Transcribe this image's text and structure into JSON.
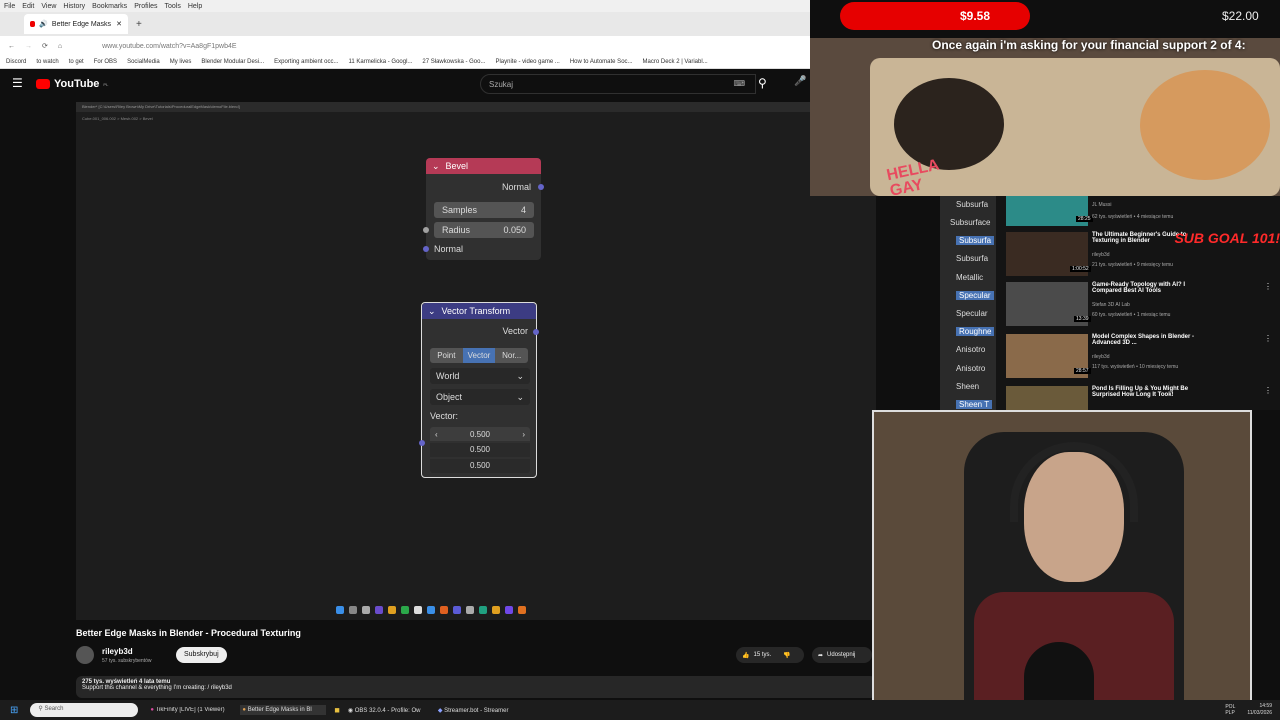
{
  "browser": {
    "menu": [
      "File",
      "Edit",
      "View",
      "History",
      "Bookmarks",
      "Profiles",
      "Tools",
      "Help"
    ],
    "tab_title": "Better Edge Masks in Blender",
    "url": "www.youtube.com/watch?v=Aa8gF1pwb4E",
    "bookmarks": [
      "Discord",
      "to watch",
      "to get",
      "For OBS",
      "SocialMedia",
      "My lives",
      "Blender Modular Desi...",
      "Exporting ambient occ...",
      "11 Karmelicka - Googl...",
      "27 Sławkowska - Goo...",
      "Playnite - video game ...",
      "How to Automate Soc...",
      "Macro Deck 2 | Variabl..."
    ]
  },
  "youtube": {
    "logo": "YouTube",
    "logo_region": "PL",
    "search_placeholder": "Szukaj",
    "video_title": "Better Edge Masks in Blender - Procedural Texturing",
    "channel_name": "rileyb3d",
    "subscribers": "57 tys. subskrybentów",
    "subscribe_label": "Subskrybuj",
    "likes": "15 tys.",
    "share_label": "Udostępnij",
    "views_line": "275 tys. wyświetleń  4 lata temu",
    "desc_line": "Support this channel & everything I'm creating:  / rileyb3d"
  },
  "blender": {
    "window_title": "Blender* [C:\\Users\\Riley Brown\\My Drive\\Tutorials\\ProceduralEdgeMask\\demoFile.blend]",
    "breadcrumb": "Cube.001_006.002  >  Mesh.002  >  Bevel",
    "bevel": {
      "title": "Bevel",
      "output": "Normal",
      "samples_label": "Samples",
      "samples_value": "4",
      "radius_label": "Radius",
      "radius_value": "0.050",
      "input": "Normal"
    },
    "vector_transform": {
      "title": "Vector Transform",
      "output": "Vector",
      "modes": [
        "Point",
        "Vector",
        "Nor..."
      ],
      "active_mode": "Vector",
      "from": "World",
      "to": "Object",
      "vector_label": "Vector:",
      "values": [
        "0.500",
        "0.500",
        "0.500"
      ]
    }
  },
  "stream": {
    "tip_amount": "$9.58",
    "goal_amount": "$22.00",
    "ticker": "Once again i'm asking for your financial support 2 of 4:",
    "sticker": "HELLA GAY",
    "sub_goal": "SUB GOAL 101!"
  },
  "material_panel": [
    "Subsurfa",
    "Subsurface",
    "Subsurfa",
    "Subsurfa",
    "Metallic",
    "Specular",
    "Specular",
    "Roughne",
    "Anisotro",
    "Anisotro",
    "Sheen",
    "Sheen T"
  ],
  "recommendations": [
    {
      "title": "",
      "channel": "JL Mussi",
      "meta": "62 tys. wyświetleń • 4 miesiące temu",
      "duration": "28:25"
    },
    {
      "title": "The Ultimate Beginner's Guide to Texturing in Blender",
      "channel": "rileyb3d",
      "meta": "21 tys. wyświetleń • 9 miesięcy temu",
      "duration": "1:00:52"
    },
    {
      "title": "Game-Ready Topology with AI? I Compared Best AI Tools",
      "channel": "Stefan 3D AI Lab",
      "meta": "60 tys. wyświetleń • 1 miesiąc temu",
      "duration": "13:39"
    },
    {
      "title": "Model Complex Shapes in Blender - Advanced 3D ...",
      "channel": "rileyb3d",
      "meta": "117 tys. wyświetleń • 10 miesięcy temu",
      "duration": "28:57"
    },
    {
      "title": "Pond Is Filling Up & You Might Be Surprised How Long It Took!",
      "channel": "",
      "meta": "",
      "duration": ""
    }
  ],
  "taskbar": {
    "search_placeholder": "Search",
    "apps": [
      "TikFinity [LIVE] (1 Viewer)",
      "Better Edge Masks in Bl",
      "OBS 32.0.4 - Profile: Ow",
      "Streamer.bot - Streamer"
    ],
    "lang": "POL\nPLP",
    "time": "14:59",
    "date": "11/03/2026"
  }
}
